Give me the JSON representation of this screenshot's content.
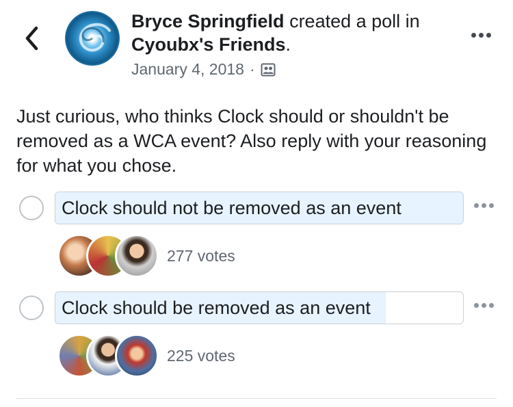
{
  "header": {
    "author": "Bryce Springfield",
    "action": " created a poll in ",
    "group": "Cyoubx's Friends",
    "period": ".",
    "date": "January 4, 2018",
    "separator": "·"
  },
  "post": {
    "text": "Just curious, who thinks Clock should or shouldn't be removed as a WCA event? Also reply with your reasoning for what you chose."
  },
  "poll": {
    "options": [
      {
        "label": "Clock should not be removed as an event",
        "votes": "277 votes",
        "fill_fraction": 1.0
      },
      {
        "label": "Clock should be removed as an event",
        "votes": "225 votes",
        "fill_fraction": 0.81
      }
    ]
  },
  "icons": {
    "back": "chevron-left-icon",
    "more": "more-horizontal-icon",
    "audience": "group-audience-icon"
  },
  "colors": {
    "bar_fill": "#e7f3ff",
    "secondary_text": "#606770"
  }
}
